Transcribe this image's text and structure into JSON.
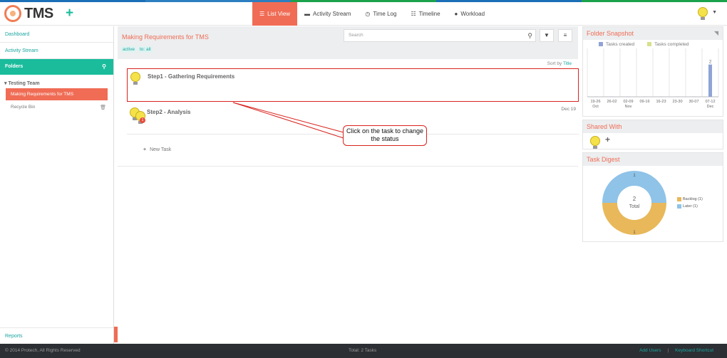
{
  "colors": {
    "accent": "#f06c55",
    "teal": "#1abc9c",
    "stripe": [
      "#1b6fb6",
      "#2b7fc0",
      "#1aa24a",
      "#1b6fb6",
      "#1aa24a"
    ]
  },
  "app": {
    "name": "TMS"
  },
  "nav": [
    {
      "label": "List View",
      "icon": "list-icon",
      "active": true
    },
    {
      "label": "Activity Stream",
      "icon": "comment-icon",
      "active": false
    },
    {
      "label": "Time Log",
      "icon": "clock-icon",
      "active": false
    },
    {
      "label": "Timeline",
      "icon": "timeline-icon",
      "active": false
    },
    {
      "label": "Workload",
      "icon": "user-icon",
      "active": false
    }
  ],
  "sidebar": {
    "dashboard": "Dashboard",
    "activity": "Activity Stream",
    "folders": "Folders",
    "team": "Testing Team",
    "active_folder": "Making Requirements for TMS",
    "recycle": "Recycle Bin",
    "reports": "Reports"
  },
  "main": {
    "title": "Making Requirements for TMS",
    "tags": [
      "active",
      "to: all"
    ],
    "search_placeholder": "Search",
    "sort_prefix": "Sort by",
    "sort_field": "Title",
    "tasks": [
      {
        "title": "Step1 - Gathering Requirements",
        "date": ""
      },
      {
        "title": "Step2 - Analysis",
        "date": "Dec 19",
        "badge": "1"
      }
    ],
    "new_task": "New Task"
  },
  "callout": "Click on the task to change the status",
  "snapshot": {
    "title": "Folder Snapshot",
    "legend_created": "Tasks created",
    "legend_completed": "Tasks completed",
    "color_created": "#8fa3d6",
    "color_completed": "#d8e08c",
    "ticks": [
      {
        "date": "19-26",
        "month": "Oct"
      },
      {
        "date": "26-02",
        "month": ""
      },
      {
        "date": "02-09",
        "month": "Nov"
      },
      {
        "date": "09-16",
        "month": ""
      },
      {
        "date": "16-23",
        "month": ""
      },
      {
        "date": "23-30",
        "month": ""
      },
      {
        "date": "30-07",
        "month": ""
      },
      {
        "date": "07-12",
        "month": "Dec"
      }
    ],
    "created": [
      0,
      0,
      0,
      0,
      0,
      0,
      0,
      2
    ],
    "bar_label": "2"
  },
  "shared": {
    "title": "Shared With"
  },
  "digest": {
    "title": "Task Digest",
    "total_value": "2",
    "total_label": "Total",
    "slice_label_top": "1",
    "slice_label_bottom": "1",
    "legend": [
      {
        "label": "Backlog (1)",
        "color": "#e8b85a"
      },
      {
        "label": "Later (1)",
        "color": "#8fc3e8"
      }
    ]
  },
  "footer": {
    "copyright": "© 2014 Protech, All Rights Reserved",
    "total": "Total: 2 Tasks",
    "add_users": "Add Users",
    "shortcut": "Keyboard Shortcut"
  }
}
